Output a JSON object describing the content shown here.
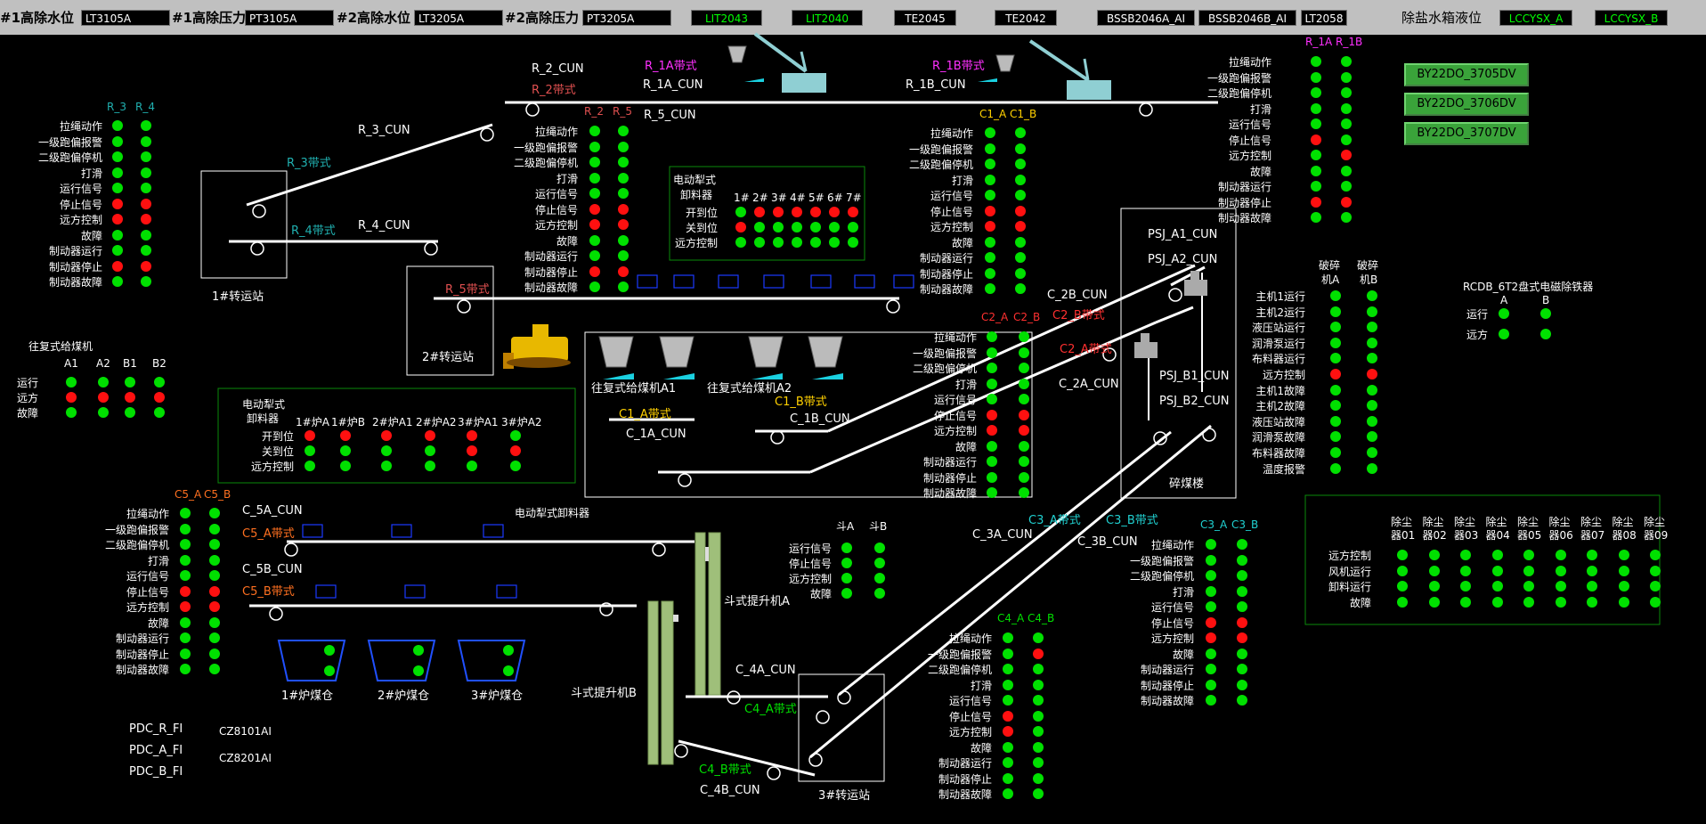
{
  "topbar": {
    "items": [
      {
        "label": "#1高除水位",
        "value": "LT3105A"
      },
      {
        "label": "#1高除压力",
        "value": "PT3105A"
      },
      {
        "label": "#2高除水位",
        "value": "LT3205A"
      },
      {
        "label": "#2高除压力",
        "value": "PT3205A"
      }
    ],
    "tags": [
      "LIT2043",
      "LIT2040",
      "TE2045",
      "TE2042",
      "BSSB2046A_AI",
      "BSSB2046B_AI",
      "LT2058"
    ],
    "salt_label": "除盐水箱液位",
    "salt_values": [
      "LCCYSX_A",
      "LCCYSX_B"
    ]
  },
  "status_rows": [
    "拉绳动作",
    "一级跑偏报警",
    "二级跑偏停机",
    "打滑",
    "运行信号",
    "停止信号",
    "远方控制",
    "故障",
    "制动器运行",
    "制动器停止",
    "制动器故障"
  ],
  "groups": {
    "r34": {
      "headers": [
        "R_3",
        "R_4"
      ],
      "header_color": "#20b0b0",
      "states": [
        "gg",
        "gg",
        "gg",
        "gg",
        "gg",
        "rr",
        "rr",
        "gg",
        "gg",
        "rr",
        "gg"
      ]
    },
    "r25": {
      "headers": [
        "R_2",
        "R_5"
      ],
      "header_color": "#e05050",
      "states": [
        "gg",
        "gg",
        "gg",
        "gg",
        "gg",
        "rr",
        "rr",
        "gg",
        "gg",
        "rr",
        "gg"
      ]
    },
    "c1": {
      "headers": [
        "C1_A",
        "C1_B"
      ],
      "header_color": "#ffd000",
      "states": [
        "gg",
        "gg",
        "gg",
        "gg",
        "gg",
        "rr",
        "rr",
        "gg",
        "gg",
        "gg",
        "gg"
      ]
    },
    "r1": {
      "headers": [
        "R_1A",
        "R_1B"
      ],
      "header_color": "#ff30ff",
      "states": [
        "gg",
        "gg",
        "gg",
        "gg",
        "gg",
        "rg",
        "gr",
        "gg",
        "gg",
        "rr",
        "gg"
      ]
    },
    "c2": {
      "headers": [
        "C2_A",
        "C2_B"
      ],
      "header_color": "#ff3030",
      "states": [
        "gg",
        "gg",
        "gg",
        "gg",
        "gg",
        "rr",
        "rr",
        "gg",
        "gg",
        "gg",
        "gg"
      ]
    },
    "c5": {
      "headers": [
        "C5_A",
        "C5_B"
      ],
      "header_color": "#ff7020",
      "states": [
        "gg",
        "gg",
        "gg",
        "gg",
        "gg",
        "rr",
        "rr",
        "gg",
        "gg",
        "gg",
        "gg"
      ]
    },
    "c3": {
      "headers": [
        "C3_A",
        "C3_B"
      ],
      "header_color": "#20d0d0",
      "states": [
        "gg",
        "gg",
        "gg",
        "gg",
        "gg",
        "rr",
        "rr",
        "gg",
        "gg",
        "gg",
        "gg"
      ]
    },
    "c4": {
      "headers": [
        "C4_A",
        "C4_B"
      ],
      "header_color": "#00e000",
      "states": [
        "gg",
        "gr",
        "gg",
        "gg",
        "gg",
        "rg",
        "rg",
        "gg",
        "gg",
        "gg",
        "gg"
      ]
    }
  },
  "belts": {
    "r2_cun": "R_2_CUN",
    "r2_belt": "R_2带式",
    "r1a_belt": "R_1A带式",
    "r1a_cun": "R_1A_CUN",
    "r1b_belt": "R_1B带式",
    "r1b_cun": "R_1B_CUN",
    "r5_cun": "R_5_CUN",
    "r3_cun": "R_3_CUN",
    "r3_belt": "R_3带式",
    "r4_belt": "R_4带式",
    "r4_cun": "R_4_CUN",
    "r5_belt": "R_5带式",
    "c2b_cun": "C_2B_CUN",
    "c2b_belt": "C2_B带式",
    "c2a_belt": "C2_A带式",
    "c2a_cun": "C_2A_CUN",
    "c1a_belt": "C1_A带式",
    "c1a_cun": "C_1A_CUN",
    "c1b_belt": "C1_B带式",
    "c1b_cun": "C_1B_CUN",
    "c5a_cun": "C_5A_CUN",
    "c5a_belt": "C5_A带式",
    "c5b_cun": "C_5B_CUN",
    "c5b_belt": "C5_B带式",
    "c3a_belt": "C3_A带式",
    "c3a_cun": "C_3A_CUN",
    "c3b_belt": "C3_B带式",
    "c3b_cun": "C_3B_CUN",
    "c4a_cun": "C_4A_CUN",
    "c4a_belt": "C4_A带式",
    "c4b_belt": "C4_B带式",
    "c4b_cun": "C_4B_CUN",
    "psj_a1": "PSJ_A1_CUN",
    "psj_a2": "PSJ_A2_CUN",
    "psj_b1": "PSJ_B1_CUN",
    "psj_b2": "PSJ_B2_CUN"
  },
  "stations": {
    "s1": "1#转运站",
    "s2": "2#转运站",
    "s3": "3#转运站",
    "crusher": "碎煤楼",
    "feeder_a1": "往复式给煤机A1",
    "feeder_a2": "往复式给煤机A2",
    "elevator_a": "斗式提升机A",
    "elevator_b": "斗式提升机B",
    "bunker1": "1#炉煤仓",
    "bunker2": "2#炉煤仓",
    "bunker3": "3#炉煤仓",
    "plough_ele": "电动犁式卸料器"
  },
  "plough_top": {
    "title1": "电动犁式",
    "title2": "卸料器",
    "cols": [
      "1#",
      "2#",
      "3#",
      "4#",
      "5#",
      "6#",
      "7#"
    ],
    "rows": [
      {
        "label": "开到位",
        "states": "grrrrrr"
      },
      {
        "label": "关到位",
        "states": "rgggggg"
      },
      {
        "label": "远方控制",
        "states": "ggggggg"
      }
    ]
  },
  "plough_left": {
    "title1": "电动犁式",
    "title2": "卸料器",
    "cols": [
      "1#炉A",
      "1#炉B",
      "2#炉A1",
      "2#炉A2",
      "3#炉A1",
      "3#炉A2"
    ],
    "rows": [
      {
        "label": "开到位",
        "states": "rrrrrg"
      },
      {
        "label": "关到位",
        "states": "ggggr r"
      },
      {
        "label": "远方控制",
        "states": "gggggg"
      }
    ]
  },
  "feeder_table": {
    "title": "往复式给煤机",
    "cols": [
      "A1",
      "A2",
      "B1",
      "B2"
    ],
    "rows": [
      {
        "label": "运行",
        "states": "gggg"
      },
      {
        "label": "远方",
        "states": "rrrr"
      },
      {
        "label": "故障",
        "states": "gggg"
      }
    ]
  },
  "bucket_table": {
    "cols": [
      "斗A",
      "斗B"
    ],
    "rows": [
      {
        "label": "运行信号",
        "states": "gg"
      },
      {
        "label": "停止信号",
        "states": "gg"
      },
      {
        "label": "远方控制",
        "states": "gg"
      },
      {
        "label": "故障",
        "states": "gg"
      }
    ]
  },
  "crusher_table": {
    "cols": [
      "破碎机A",
      "破碎机B"
    ],
    "rows": [
      {
        "label": "主机1运行",
        "states": "gg"
      },
      {
        "label": "主机2运行",
        "states": "gg"
      },
      {
        "label": "液压站运行",
        "states": "gg"
      },
      {
        "label": "润滑泵运行",
        "states": "gg"
      },
      {
        "label": "布料器运行",
        "states": "gg"
      },
      {
        "label": "远方控制",
        "states": "rr"
      },
      {
        "label": "主机1故障",
        "states": "gg"
      },
      {
        "label": "主机2故障",
        "states": "gg"
      },
      {
        "label": "液压站故障",
        "states": "gg"
      },
      {
        "label": "润滑泵故障",
        "states": "gg"
      },
      {
        "label": "布料器故障",
        "states": "gg"
      },
      {
        "label": "温度报警",
        "states": "gg"
      }
    ]
  },
  "magnet": {
    "title": "RCDB_6T2盘式电磁除铁器",
    "cols": [
      "A",
      "B"
    ],
    "rows": [
      {
        "label": "运行",
        "states": "gg"
      },
      {
        "label": "远方",
        "states": "gg"
      }
    ]
  },
  "dust": {
    "cols": [
      "除尘器01",
      "除尘器02",
      "除尘器03",
      "除尘器04",
      "除尘器05",
      "除尘器06",
      "除尘器07",
      "除尘器08",
      "除尘器09"
    ],
    "rows": [
      {
        "label": "远方控制",
        "states": "ggggggggg"
      },
      {
        "label": "风机运行",
        "states": "ggggggggg"
      },
      {
        "label": "卸料运行",
        "states": "ggggggggg"
      },
      {
        "label": "故障",
        "states": "ggggggggg"
      }
    ]
  },
  "buttons": [
    "BY22DO_3705DV",
    "BY22DO_3706DV",
    "BY22DO_3707DV"
  ],
  "pdc": {
    "r": "PDC_R_FI",
    "a": "PDC_A_FI",
    "b": "PDC_B_FI",
    "cz1": "CZ8101AI",
    "cz2": "CZ8201AI"
  }
}
